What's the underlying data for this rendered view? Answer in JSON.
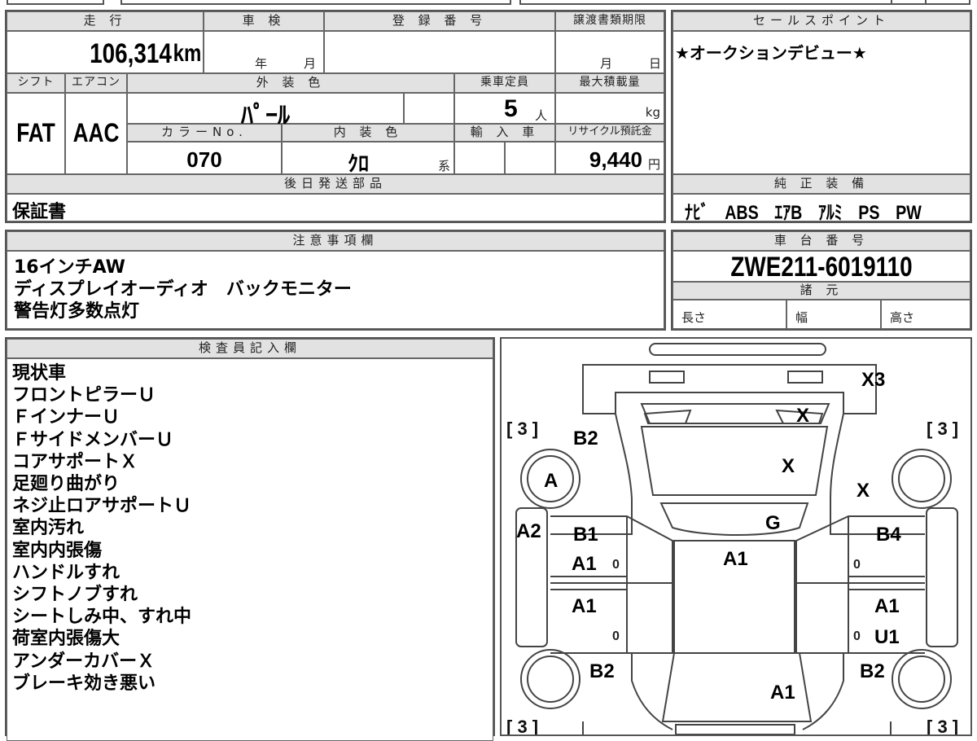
{
  "headers": {
    "mileage": "走 行",
    "inspection": "車 検",
    "registration": "登 録 番 号",
    "transfer_deadline": "譲渡書類期限",
    "sales_point": "セールスポイント",
    "shift": "シフト",
    "aircon": "エアコン",
    "exterior_color": "外 装 色",
    "capacity": "乗車定員",
    "max_load": "最大積載量",
    "color_no": "カラーNo.",
    "interior_color": "内 装 色",
    "imported": "輸 入 車",
    "recycle": "リサイクル預託金",
    "later_parts": "後日発送部品",
    "standard_equipment": "純 正 装 備",
    "notes": "注意事項欄",
    "chassis_no": "車 台 番 号",
    "specs": "諸 元",
    "inspector": "検査員記入欄"
  },
  "vehicle": {
    "mileage": "106,314",
    "mileage_unit": "km",
    "inspection_year_unit": "年",
    "inspection_month_unit": "月",
    "deadline_month_unit": "月",
    "deadline_day_unit": "日",
    "shift": "FAT",
    "aircon": "AAC",
    "exterior_color": "ﾊﾟｰﾙ",
    "capacity": "5",
    "capacity_unit": "人",
    "max_load_unit": "kg",
    "color_no": "070",
    "interior_color": "ｸﾛ",
    "interior_color_suffix": "系",
    "recycle_fee": "9,440",
    "recycle_unit": "円",
    "chassis_no": "ZWE211-6019110"
  },
  "sales_point": "★オークションデビュー★",
  "later_parts": "保証書",
  "standard_equipment": "ﾅﾋﾞ　ABS　ｴｱB　ｱﾙﾐ　PS　PW",
  "notes_lines": [
    "16インチAW",
    "ディスプレイオーディオ　バックモニター",
    "警告灯多数点灯"
  ],
  "specs_labels": {
    "length": "長さ",
    "width": "幅",
    "height": "高さ"
  },
  "inspector_lines": [
    "現状車",
    "フロントピラーＵ",
    "ＦインナーＵ",
    "ＦサイドメンバーＵ",
    "コアサポートＸ",
    "足廻り曲がり",
    "ネジ止ロアサポートＵ",
    "室内汚れ",
    "室内内張傷",
    "ハンドルすれ",
    "シフトノブすれ",
    "シートしみ中、すれ中",
    "荷室内張傷大",
    "アンダーカバーＸ",
    "ブレーキ効き悪い"
  ],
  "diagram": {
    "tire_bracket": "[ 3 ]",
    "marks": {
      "rear_right": "X3",
      "front_glass_corner": "X",
      "hood": "X",
      "front_right_fender": "X",
      "front_left_fender": "B2",
      "front_left_wheel": "A",
      "left_rocker": "A2",
      "front_left_door_1": "B1",
      "front_left_door_2": "A1",
      "windshield": "G",
      "roof": "A1",
      "front_right_door": "B4",
      "rear_left_door": "A1",
      "rear_right_door_1": "A1",
      "rear_right_door_2": "U1",
      "rear_left_fender": "B2",
      "rear_right_fender": "B2",
      "trunk": "A1",
      "pillar_zero": "0"
    }
  }
}
